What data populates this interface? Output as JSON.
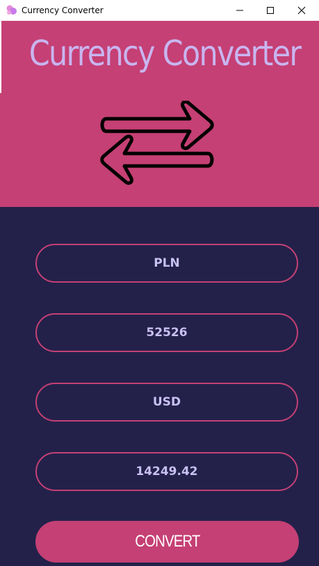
{
  "window": {
    "title": "Currency Converter",
    "icon": "bubbles-app-icon"
  },
  "header": {
    "title": "Currency Converter",
    "icon": "swap-arrows-icon"
  },
  "form": {
    "from_currency": "PLN",
    "amount": "52526",
    "to_currency": "USD",
    "result": "14249.42"
  },
  "actions": {
    "convert_label": "CONVERT"
  },
  "colors": {
    "accent": "#c54074",
    "background": "#23214a",
    "text": "#c9c0f2"
  }
}
